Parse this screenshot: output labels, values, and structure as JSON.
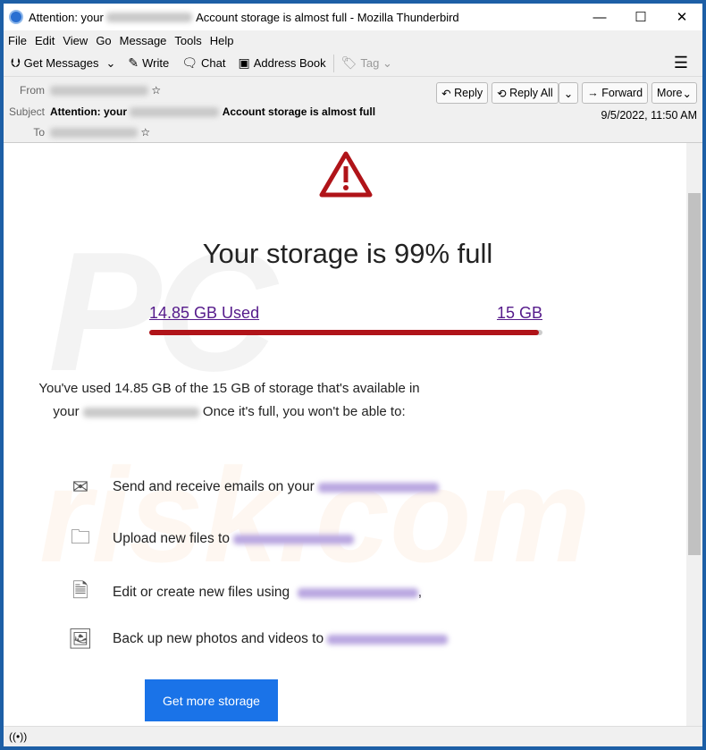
{
  "window": {
    "title_prefix": "Attention: your",
    "title_suffix": "Account storage is almost full - Mozilla Thunderbird",
    "minimize": "—",
    "maximize": "☐",
    "close": "✕"
  },
  "menu": [
    "File",
    "Edit",
    "View",
    "Go",
    "Message",
    "Tools",
    "Help"
  ],
  "toolbar": {
    "get_messages": "Get Messages",
    "write": "Write",
    "chat": "Chat",
    "address_book": "Address Book",
    "tag": "Tag"
  },
  "header": {
    "from_label": "From",
    "subject_label": "Subject",
    "to_label": "To",
    "subject_prefix": "Attention: your",
    "subject_suffix": "Account storage is almost full",
    "date": "9/5/2022, 11:50 AM",
    "reply": "Reply",
    "reply_all": "Reply All",
    "forward": "Forward",
    "more": "More"
  },
  "email": {
    "heading": "Your storage is 99% full",
    "used_link": "14.85 GB Used",
    "total_link": "15 GB",
    "usage_fraction": 0.99,
    "para_1": "You've used 14.85 GB of the  15 GB of storage that's available in your",
    "para_2": "Once it's full, you won't be able to:",
    "items": [
      {
        "icon": "envelope-icon",
        "text": "Send and receive emails on your"
      },
      {
        "icon": "folder-icon",
        "text": "Upload new files to"
      },
      {
        "icon": "document-icon",
        "text": "Edit or create new files using"
      },
      {
        "icon": "image-icon",
        "text": "Back up new photos and videos to"
      }
    ],
    "comma": ",",
    "button": "Get more storage"
  },
  "colors": {
    "accent": "#1a73e8",
    "warning": "#b01419",
    "link": "#551a8b"
  }
}
